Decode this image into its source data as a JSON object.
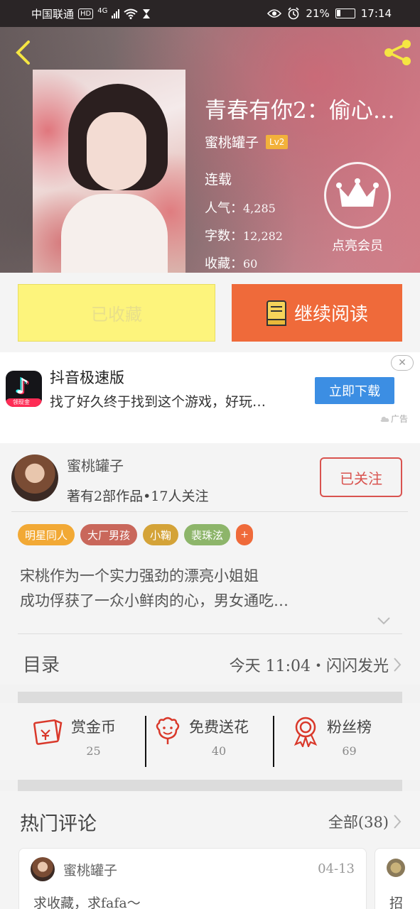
{
  "status_bar": {
    "carrier": "中国联通",
    "hd": "HD",
    "network": "4G",
    "battery_text": "21%",
    "battery_level": 0.21,
    "time": "17:14"
  },
  "book": {
    "title": "青春有你2：偷心…",
    "author": "蜜桃罐子",
    "level": "Lv2",
    "status": "连载",
    "popularity_label": "人气：",
    "popularity": "4,285",
    "words_label": "字数：",
    "words": "12,282",
    "favorites_label": "收藏：",
    "favorites": "60",
    "vip_label": "点亮会员"
  },
  "actions": {
    "collected_label": "已收藏",
    "read_label": "继续阅读"
  },
  "ad": {
    "app_name": "抖音极速版",
    "app_tag": "领现金",
    "description": "找了好久终于找到这个游戏，好玩…",
    "cta": "立即下载",
    "ad_label": "广告"
  },
  "author_section": {
    "name": "蜜桃罐子",
    "stats": "著有2部作品•17人关注",
    "follow_label": "已关注",
    "tags": [
      {
        "label": "明星同人",
        "color": "#f2a935"
      },
      {
        "label": "大厂男孩",
        "color": "#c9675b"
      },
      {
        "label": "小鞠",
        "color": "#d4a338"
      },
      {
        "label": "裴珠泫",
        "color": "#8db56a"
      }
    ],
    "more_tag": "+",
    "intro_line1": "宋桃作为一个实力强劲的漂亮小姐姐",
    "intro_line2": "成功俘获了一众小鲜肉的心，男女通吃…"
  },
  "toc": {
    "label": "目录",
    "update": "今天 11:04・闪闪发光"
  },
  "gifts": [
    {
      "label": "赏金币",
      "count": "25",
      "icon": "red-envelope-icon",
      "color": "#d9382a"
    },
    {
      "label": "免费送花",
      "count": "40",
      "icon": "flower-icon",
      "color": "#d9382a"
    },
    {
      "label": "粉丝榜",
      "count": "69",
      "icon": "medal-icon",
      "color": "#d9382a"
    }
  ],
  "hot_comments": {
    "title": "热门评论",
    "all_label": "全部(38)",
    "comments": [
      {
        "name": "蜜桃罐子",
        "date": "04-13",
        "text": "求收藏，求fafa～"
      },
      {
        "text": "招"
      }
    ]
  },
  "colors": {
    "accent": "#ef6a3a",
    "collected_bg": "#fdf47c",
    "follow": "#d9534f",
    "level_badge": "#f2b13b",
    "ad_cta": "#3c8ee3"
  }
}
